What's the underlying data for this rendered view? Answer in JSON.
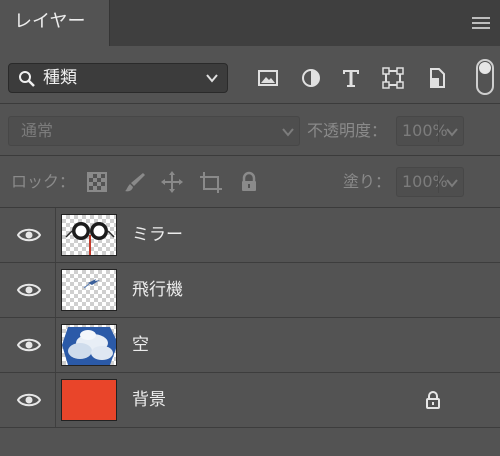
{
  "panel": {
    "tab_title": "レイヤー"
  },
  "filter": {
    "kind_label": "種類",
    "icons": [
      "image-filter-icon",
      "adjustment-filter-icon",
      "type-filter-icon",
      "shape-filter-icon",
      "smart-object-filter-icon"
    ]
  },
  "blend": {
    "mode": "通常",
    "opacity_label": "不透明度：",
    "opacity_value": "100%"
  },
  "lock": {
    "label": "ロック：",
    "fill_label": "塗り：",
    "fill_value": "100%",
    "icons": [
      "lock-transparent-pixels-icon",
      "lock-image-pixels-icon",
      "lock-position-icon",
      "lock-artboard-icon",
      "lock-all-icon"
    ]
  },
  "layers": [
    {
      "name": "ミラー",
      "thumbnail": "mirror-thumbnail",
      "visible": true,
      "locked": false
    },
    {
      "name": "飛行機",
      "thumbnail": "airplane-thumbnail",
      "visible": true,
      "locked": false
    },
    {
      "name": "空",
      "thumbnail": "sky-thumbnail",
      "visible": true,
      "locked": false
    },
    {
      "name": "背景",
      "thumbnail": "background-thumbnail",
      "visible": true,
      "locked": true,
      "color": "#e9452a"
    }
  ]
}
